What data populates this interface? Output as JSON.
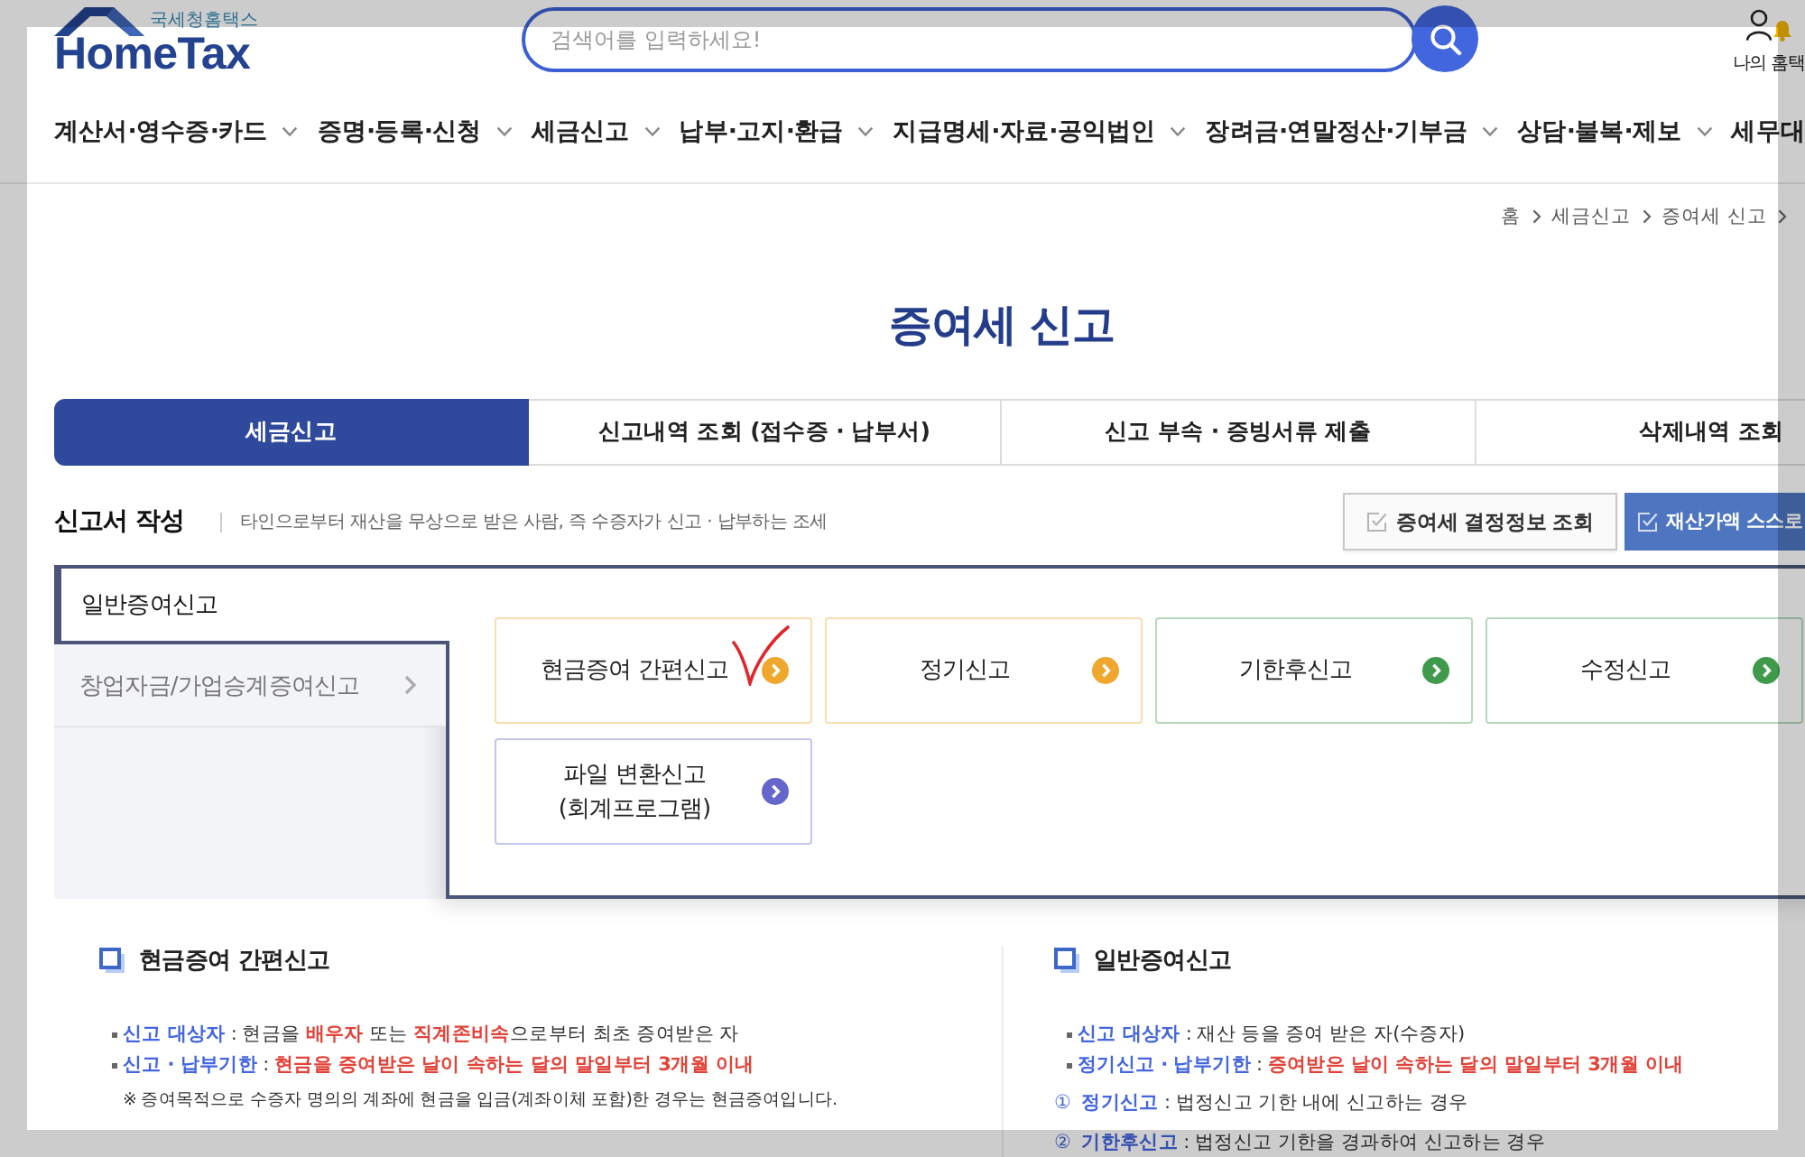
{
  "header": {
    "logo": {
      "subtitle": "국세청홈택스",
      "title": "HomeTax"
    },
    "search": {
      "placeholder": "검색어를 입력하세요!"
    },
    "user_menu": {
      "label": "나의 홈택"
    }
  },
  "nav": [
    {
      "label": "계산서·영수증·카드",
      "dropdown": true
    },
    {
      "label": "증명·등록·신청",
      "dropdown": true
    },
    {
      "label": "세금신고",
      "dropdown": true
    },
    {
      "label": "납부·고지·환급",
      "dropdown": true
    },
    {
      "label": "지급명세·자료·공익법인",
      "dropdown": true
    },
    {
      "label": "장려금·연말정산·기부금",
      "dropdown": true
    },
    {
      "label": "상담·불복·제보",
      "dropdown": true
    },
    {
      "label": "세무대",
      "dropdown": false
    }
  ],
  "breadcrumb": [
    "홈",
    "세금신고",
    "증여세 신고"
  ],
  "page_title": "증여세 신고",
  "tabs": [
    {
      "label": "세금신고",
      "selected": true
    },
    {
      "label": "신고내역 조회 (접수증 · 납부서)",
      "selected": false
    },
    {
      "label": "신고 부속 · 증빙서류 제출",
      "selected": false
    },
    {
      "label": "삭제내역 조회",
      "selected": false
    }
  ],
  "section": {
    "title": "신고서 작성",
    "description": "타인으로부터 재산을 무상으로 받은 사람, 즉 수증자가 신고 · 납부하는 조세",
    "buttons": [
      {
        "label": "증여세 결정정보 조회",
        "kind": "secondary"
      },
      {
        "label": "재산가액 스스로",
        "kind": "primary"
      }
    ]
  },
  "side_menu": [
    {
      "label": "일반증여신고",
      "selected": true
    },
    {
      "label": "창업자금/가업승계증여신고",
      "selected": false
    }
  ],
  "cards": [
    {
      "label": "현금증여 간편신고",
      "color": "#f0a72e",
      "marked": true
    },
    {
      "label": "정기신고",
      "color": "#f0a72e",
      "marked": false
    },
    {
      "label": "기한후신고",
      "color": "#3f9a4c",
      "marked": false
    },
    {
      "label": "수정신고",
      "color": "#3f9a4c",
      "marked": false
    },
    {
      "label": "파일 변환신고\n(회계프로그램)",
      "color": "#6466cc",
      "marked": false
    }
  ],
  "info": [
    {
      "title": "현금증여 간편신고",
      "lines": [
        {
          "kind": "bullet",
          "segments": [
            {
              "text": "신고 대상자",
              "kind": "label"
            },
            {
              "text": " : 현금을 ",
              "kind": "plain"
            },
            {
              "text": "배우자",
              "kind": "alert"
            },
            {
              "text": " 또는 ",
              "kind": "plain"
            },
            {
              "text": "직계존비속",
              "kind": "alert"
            },
            {
              "text": "으로부터 최초 증여받은 자",
              "kind": "plain"
            }
          ]
        },
        {
          "kind": "bullet",
          "segments": [
            {
              "text": "신고 · 납부기한",
              "kind": "label"
            },
            {
              "text": " : ",
              "kind": "plain"
            },
            {
              "text": "현금을 증여받은 날이 속하는 달의 말일부터 3개월 이내",
              "kind": "alert"
            }
          ]
        },
        {
          "kind": "note",
          "segments": [
            {
              "text": "※ 증여목적으로 수증자 명의의 계좌에 현금을 입금(계좌이체 포함)한 경우는 현금증여입니다.",
              "kind": "plain"
            }
          ]
        }
      ]
    },
    {
      "title": "일반증여신고",
      "lines": [
        {
          "kind": "bullet",
          "segments": [
            {
              "text": "신고 대상자",
              "kind": "label"
            },
            {
              "text": " : 재산 등을 증여 받은 자(수증자)",
              "kind": "plain"
            }
          ]
        },
        {
          "kind": "bullet",
          "segments": [
            {
              "text": "정기신고 · 납부기한",
              "kind": "label"
            },
            {
              "text": " : ",
              "kind": "plain"
            },
            {
              "text": "증여받은 날이 속하는 달의 말일부터 3개월 이내",
              "kind": "alert"
            }
          ]
        },
        {
          "kind": "numbered",
          "marker": "①",
          "segments": [
            {
              "text": "정기신고",
              "kind": "label"
            },
            {
              "text": " : 법정신고 기한 내에 신고하는 경우",
              "kind": "plain"
            }
          ]
        },
        {
          "kind": "numbered",
          "marker": "②",
          "segments": [
            {
              "text": "기한후신고",
              "kind": "label"
            },
            {
              "text": " : 법정신고 기한을 경과하여 신고하는 경우",
              "kind": "plain"
            }
          ]
        }
      ]
    }
  ]
}
